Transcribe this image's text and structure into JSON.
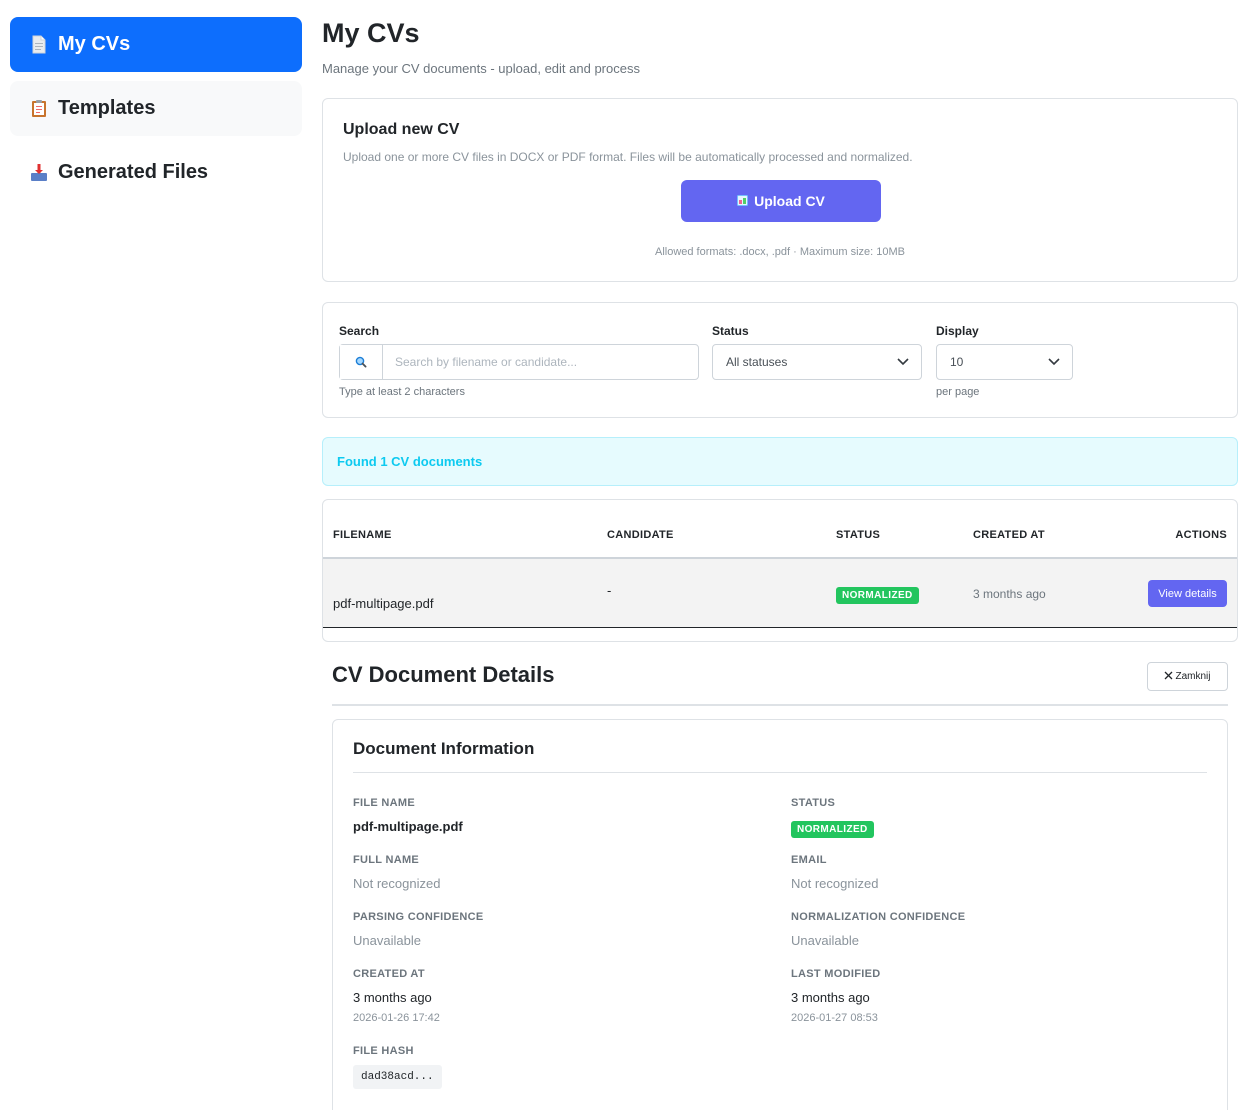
{
  "sidebar": {
    "items": [
      {
        "label": "My CVs",
        "icon": "document-icon",
        "active": true
      },
      {
        "label": "Templates",
        "icon": "clipboard-icon",
        "active": false
      },
      {
        "label": "Generated Files",
        "icon": "inbox-tray-icon",
        "active": false
      }
    ]
  },
  "header": {
    "title": "My CVs",
    "subtitle": "Manage your CV documents - upload, edit and process"
  },
  "upload": {
    "title": "Upload new CV",
    "description": "Upload one or more CV files in DOCX or PDF format. Files will be automatically processed and normalized.",
    "button_label": "Upload CV",
    "allowed": "Allowed formats: .docx, .pdf · Maximum size: 10MB"
  },
  "filters": {
    "search_label": "Search",
    "search_placeholder": "Search by filename or candidate...",
    "search_hint": "Type at least 2 characters",
    "status_label": "Status",
    "status_value": "All statuses",
    "display_label": "Display",
    "display_value": "10",
    "display_hint": "per page"
  },
  "results": {
    "found_text": "Found 1 CV documents"
  },
  "table": {
    "columns": [
      "FILENAME",
      "CANDIDATE",
      "STATUS",
      "CREATED AT",
      "ACTIONS"
    ],
    "rows": [
      {
        "filename": "pdf-multipage.pdf",
        "candidate": "-",
        "status": "NORMALIZED",
        "created_at": "3 months ago",
        "action": "View details"
      }
    ]
  },
  "details": {
    "title": "CV Document Details",
    "close_label": "Zamknij",
    "section_title": "Document Information",
    "file_name_label": "FILE NAME",
    "file_name": "pdf-multipage.pdf",
    "status_label": "STATUS",
    "status": "NORMALIZED",
    "full_name_label": "FULL NAME",
    "full_name": "Not recognized",
    "email_label": "EMAIL",
    "email": "Not recognized",
    "parsing_conf_label": "PARSING CONFIDENCE",
    "parsing_conf": "Unavailable",
    "norm_conf_label": "NORMALIZATION CONFIDENCE",
    "norm_conf": "Unavailable",
    "created_label": "CREATED AT",
    "created_rel": "3 months ago",
    "created_abs": "2026-01-26 17:42",
    "modified_label": "LAST MODIFIED",
    "modified_rel": "3 months ago",
    "modified_abs": "2026-01-27 08:53",
    "hash_label": "FILE HASH",
    "hash": "dad38acd..."
  },
  "colors": {
    "primary": "#0d6efd",
    "accent": "#6366f1",
    "success": "#22c55e",
    "info": "#0dcaf0"
  }
}
